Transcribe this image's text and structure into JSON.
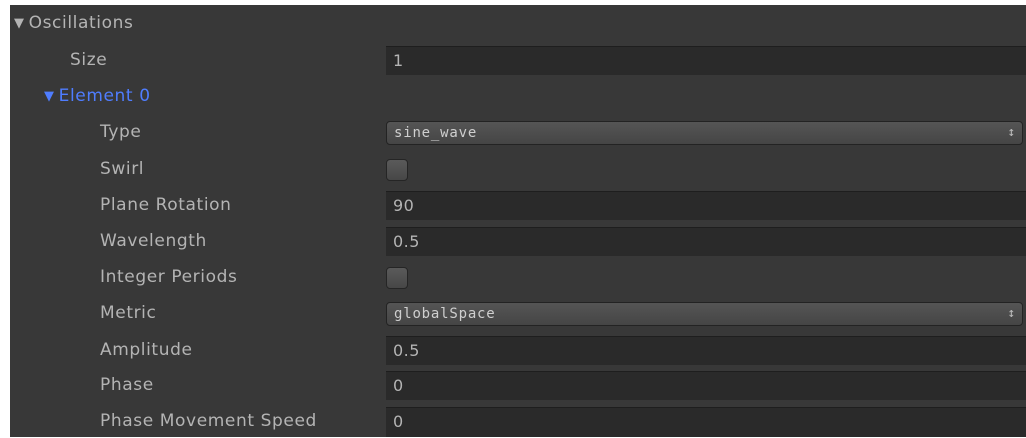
{
  "inspector": {
    "oscillations_label": "Oscillations",
    "size_label": "Size",
    "size_value": "1",
    "element_label": "Element 0",
    "type_label": "Type",
    "type_value": "sine_wave",
    "swirl_label": "Swirl",
    "swirl_checked": false,
    "plane_rotation_label": "Plane Rotation",
    "plane_rotation_value": "90",
    "wavelength_label": "Wavelength",
    "wavelength_value": "0.5",
    "integer_periods_label": "Integer Periods",
    "integer_periods_checked": false,
    "metric_label": "Metric",
    "metric_value": "globalSpace",
    "amplitude_label": "Amplitude",
    "amplitude_value": "0.5",
    "phase_label": "Phase",
    "phase_value": "0",
    "phase_speed_label": "Phase Movement Speed",
    "phase_speed_value": "0"
  },
  "icons": {
    "foldout_open": "triangle-down-icon",
    "dropdown": "updown-arrows-icon"
  },
  "colors": {
    "panel_bg": "#383838",
    "field_bg": "#2a2a2a",
    "text": "#b4b4b4",
    "selected_foldout": "#4f7dff"
  }
}
